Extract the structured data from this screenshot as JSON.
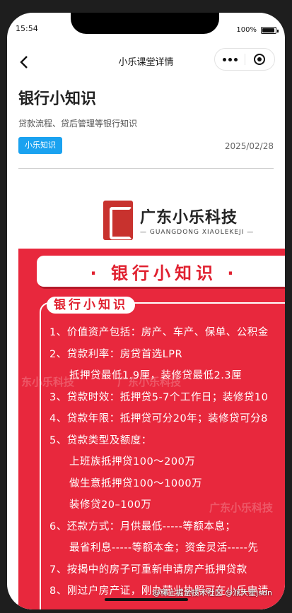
{
  "status": {
    "time": "15:54",
    "battery": "100%"
  },
  "navbar": {
    "title": "小乐课堂详情"
  },
  "article": {
    "title": "银行小知识",
    "subtitle": "贷款流程、贷后管理等银行知识",
    "tag": "小乐知识",
    "date": "2025/02/28"
  },
  "poster": {
    "logo_cn": "广东小乐科技",
    "logo_en": "— GUANGDONG XIAOLEKEJI —",
    "banner": "· 银行小知识 ·",
    "list_tab": "银行小知识",
    "items": [
      {
        "text": "1、价值资产包括：房产、车产、保单、公积金",
        "sub": false
      },
      {
        "text": "2、贷款利率：房贷首选LPR",
        "sub": false
      },
      {
        "text": "抵押贷最低1.9厘，装修贷最低2.3厘",
        "sub": true
      },
      {
        "text": "3、贷款时效：抵押贷5-7个工作日；装修贷10",
        "sub": false
      },
      {
        "text": "4、贷款年限：抵押贷可分20年；装修贷可分8",
        "sub": false
      },
      {
        "text": "5、贷款类型及额度：",
        "sub": false
      },
      {
        "text": "上班族抵押贷100～200万",
        "sub": true
      },
      {
        "text": "做生意抵押贷100～1000万",
        "sub": true
      },
      {
        "text": "装修贷20–100万",
        "sub": true
      },
      {
        "text": "6、还款方式：月供最低-----等额本息；",
        "sub": false
      },
      {
        "text": "最省利息-----等额本金；资金灵活-----先",
        "sub": true
      },
      {
        "text": "7、按揭中的房子可重新申请房产抵押贷款",
        "sub": false
      },
      {
        "text": "8、刚过户房产证，刚办营业执照可在小乐申请",
        "sub": false
      }
    ],
    "watermarks": [
      "东小乐科技",
      "广东小乐科技",
      "广东小乐科技"
    ]
  },
  "corner_mark": "@稀土掘金技术社区 @派大星jsdn"
}
